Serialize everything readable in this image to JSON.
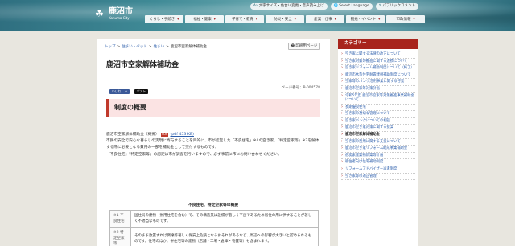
{
  "header": {
    "logo_mark": "☘",
    "logo_jp": "鹿沼市",
    "logo_en": "Kanuma City",
    "utility": [
      {
        "icon": "text-size-icon",
        "glyph": "Aa",
        "label": "文字サイズ・色合い変更・音声読み上げ"
      },
      {
        "icon": "language-icon",
        "glyph": "🌐",
        "label": "Select Language"
      },
      {
        "icon": "public-comment-icon",
        "glyph": "✎",
        "label": "パブリックコメント"
      }
    ],
    "nav": [
      {
        "label": "くらし・手続き",
        "w": 48
      },
      {
        "label": "福祉・健康",
        "w": 48
      },
      {
        "label": "子育て・教育",
        "w": 48
      },
      {
        "label": "防災・安全",
        "w": 48
      },
      {
        "label": "産業・仕事",
        "w": 48
      },
      {
        "label": "観光・イベント",
        "w": 48
      },
      {
        "label": "市政情報",
        "w": 48
      }
    ]
  },
  "main": {
    "breadcrumb": [
      "トップ",
      "住まい・ペット",
      "住まい",
      "鹿沼市空家解体補助金"
    ],
    "print_label": "印刷用ページ",
    "print_glyph": "🖶",
    "title": "鹿沼市空家解体補助金",
    "page_no": "ページ番号：P-004578",
    "fb_label": "いいね！ 0",
    "x_label": "ポスト",
    "section_heading": "制度の概要",
    "intro": {
      "line1_prefix": "鹿沼市空家解体補助金（概要）",
      "pdf_glyph": "PDF",
      "pdf_link": "(pdf 453 KB)",
      "para": "市民の安全で安心な暮らしの実現に寄与することを目的に、市が認定した「不良住宅」※1の空き家、「特定空家等」※2を解体する際に必要となる費用の一部を補助金として交付するものです。",
      "para2": "「不良住宅」「特定空家等」の認定は市が調査を行いますので、必ず事前に市にお問い合わせください。"
    },
    "table_caption": "不良住宅、特定空家等の概要",
    "table": [
      {
        "k": "※1 不良住宅",
        "v": "国住局の建物（併用住宅を含む）で、その構造又は設備が著しく不良であるため居住の用に供することが著しく不適当なものです。"
      },
      {
        "k": "※2 特定空家等",
        "v": "そのまま放置すれば倒壊等著しく保安上危険となるおそれがあるなど、周辺への影響が大きいと認められるものです。住宅のほか、併住宅等の建物（店舗・工場・倉庫・物置等）も含まれます。"
      }
    ]
  },
  "sidebar": {
    "heading": "カテゴリー",
    "items": [
      {
        "label": "空き家に関する法律の改正について",
        "current": false
      },
      {
        "label": "空き家対策の推進に関する連携について",
        "current": false
      },
      {
        "label": "空き家リフォーム補助制度について（終了）",
        "current": false
      },
      {
        "label": "鹿沼市木造住宅耐震建替補助制度について",
        "current": false
      },
      {
        "label": "空家等のバンク活用事業に関する啓発",
        "current": false
      },
      {
        "label": "鹿沼市空家等対策計画",
        "current": false
      },
      {
        "label": "令和5年度 鹿沼市空家等対策推進事業補助金について",
        "current": false
      },
      {
        "label": "長期優良住宅",
        "current": false
      },
      {
        "label": "空き家の適切な管理について",
        "current": false
      },
      {
        "label": "空き家バンクについての相談",
        "current": false
      },
      {
        "label": "鹿沼市空き家対策に関する提案",
        "current": false
      },
      {
        "label": "鹿沼市空家解体補助金",
        "current": true
      },
      {
        "label": "空き家の活用に関する支援について",
        "current": false
      },
      {
        "label": "鹿沼市空き家リフォーム助成事業補助金",
        "current": false
      },
      {
        "label": "低炭素建築物新築等計画",
        "current": false
      },
      {
        "label": "移住者向け住宅補助制度",
        "current": false
      },
      {
        "label": "リフォームアドバイザー派遣制度",
        "current": false
      },
      {
        "label": "空き家等の適正管理",
        "current": false
      }
    ]
  },
  "colors": {
    "accent": "#a8241c",
    "link": "#2a5caa",
    "section_bg": "#fbe3e3"
  }
}
